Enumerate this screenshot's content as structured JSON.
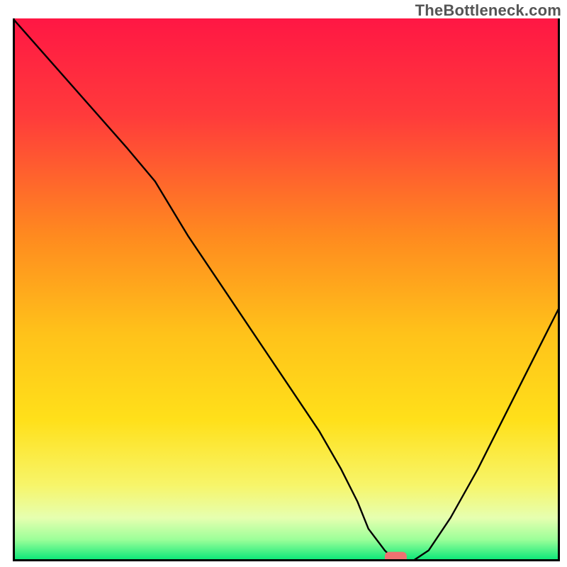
{
  "watermark": "TheBottleneck.com",
  "chart_data": {
    "type": "line",
    "title": "",
    "xlabel": "",
    "ylabel": "",
    "xlim": [
      0,
      100
    ],
    "ylim": [
      0,
      100
    ],
    "gradient_stops": [
      {
        "offset": 0,
        "color": "#ff1744"
      },
      {
        "offset": 18,
        "color": "#ff3b3b"
      },
      {
        "offset": 40,
        "color": "#ff8a1f"
      },
      {
        "offset": 58,
        "color": "#ffc21a"
      },
      {
        "offset": 74,
        "color": "#ffe01a"
      },
      {
        "offset": 86,
        "color": "#f7f56a"
      },
      {
        "offset": 92,
        "color": "#e6ffb0"
      },
      {
        "offset": 96,
        "color": "#9cff99"
      },
      {
        "offset": 100,
        "color": "#00e676"
      }
    ],
    "series": [
      {
        "name": "bottleneck-curve",
        "x": [
          0,
          7,
          14,
          21,
          26,
          32,
          38,
          44,
          50,
          56,
          60,
          63,
          65,
          68,
          70,
          73,
          76,
          80,
          85,
          90,
          95,
          100
        ],
        "y": [
          100,
          92,
          84,
          76,
          70,
          60,
          51,
          42,
          33,
          24,
          17,
          11,
          6,
          2,
          0,
          0,
          2,
          8,
          17,
          27,
          37,
          47
        ]
      }
    ],
    "marker": {
      "name": "optimal-marker",
      "x": 70,
      "y": 0,
      "color": "#ef7171",
      "width": 4,
      "height": 2
    },
    "axes": {
      "show_border_left": true,
      "show_border_bottom": true,
      "show_border_right": true,
      "border_color": "#000000"
    }
  }
}
